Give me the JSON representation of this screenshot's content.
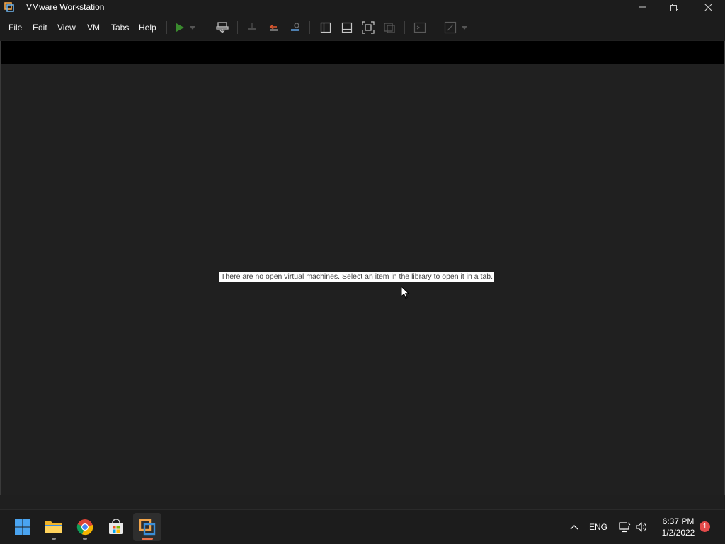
{
  "window": {
    "title": "VMware Workstation"
  },
  "menu": [
    "File",
    "Edit",
    "View",
    "VM",
    "Tabs",
    "Help"
  ],
  "toolbar_icons": [
    "power-on-icon",
    "power-dropdown-icon",
    "send-ctrl-alt-del-icon",
    "snapshot-icon",
    "revert-snapshot-icon",
    "snapshot-manager-icon",
    "show-library-icon",
    "show-thumbnail-bar-icon",
    "full-screen-icon",
    "unity-icon",
    "console-view-icon",
    "stretch-guest-icon",
    "stretch-dropdown-icon"
  ],
  "main": {
    "empty_message": "There are no open virtual machines. Select an item in the library to open it in a tab."
  },
  "taskbar": {
    "apps": [
      "start-icon",
      "file-explorer-icon",
      "chrome-icon",
      "microsoft-store-icon",
      "vmware-workstation-icon"
    ],
    "language": "ENG",
    "time": "6:37 PM",
    "date": "1/2/2022",
    "notification_count": "1"
  },
  "colors": {
    "accent_green": "#3a8a2e",
    "accent_orange": "#e8704a",
    "taskbar_bg": "#1c1c1c",
    "content_bg": "#202020"
  }
}
